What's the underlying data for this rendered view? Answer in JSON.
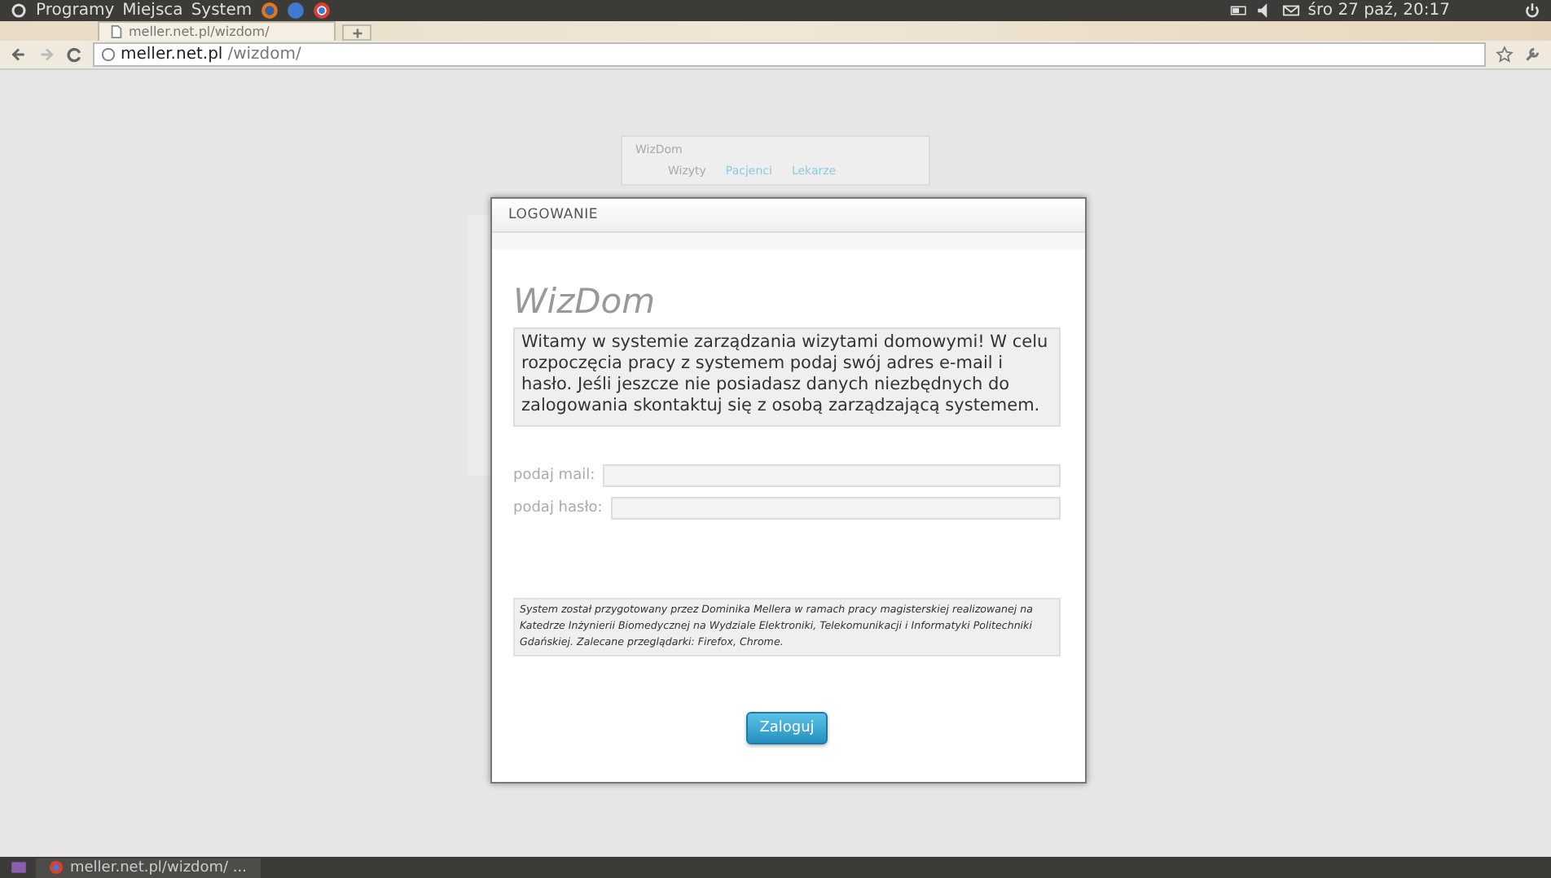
{
  "top_panel": {
    "menus": [
      "Programy",
      "Miejsca",
      "System"
    ],
    "clock": "śro 27 paź, 20:17"
  },
  "browser": {
    "tab_title": "meller.net.pl/wizdom/",
    "address_host": "meller.net.pl",
    "address_path": "/wizdom/"
  },
  "background_app": {
    "title": "WizDom",
    "nav": [
      {
        "label": "Wizyty",
        "selected": true
      },
      {
        "label": "Pacjenci",
        "selected": false
      },
      {
        "label": "Lekarze",
        "selected": false
      }
    ]
  },
  "login_dialog": {
    "title": "LOGOWANIE",
    "heading": "WizDom",
    "intro": "Witamy w systemie zarządzania wizytami domowymi! W celu rozpoczęcia pracy z systemem podaj swój adres e-mail i hasło. Jeśli jeszcze nie posiadasz danych niezbędnych do zalogowania skontaktuj się z osobą zarządzającą systemem.",
    "fields": [
      {
        "label": "podaj mail:"
      },
      {
        "label": "podaj hasło:"
      }
    ],
    "footer_note": "System został przygotowany przez Dominika Mellera w ramach pracy magisterskiej realizowanej na Katedrze Inżynierii Biomedycznej na Wydziale Elektroniki, Telekomunikacji i Informatyki Politechniki Gdańskiej. Zalecane przeglądarki: Firefox, Chrome.",
    "submit": "Zaloguj"
  },
  "taskbar": {
    "window_title": "meller.net.pl/wizdom/ ..."
  }
}
